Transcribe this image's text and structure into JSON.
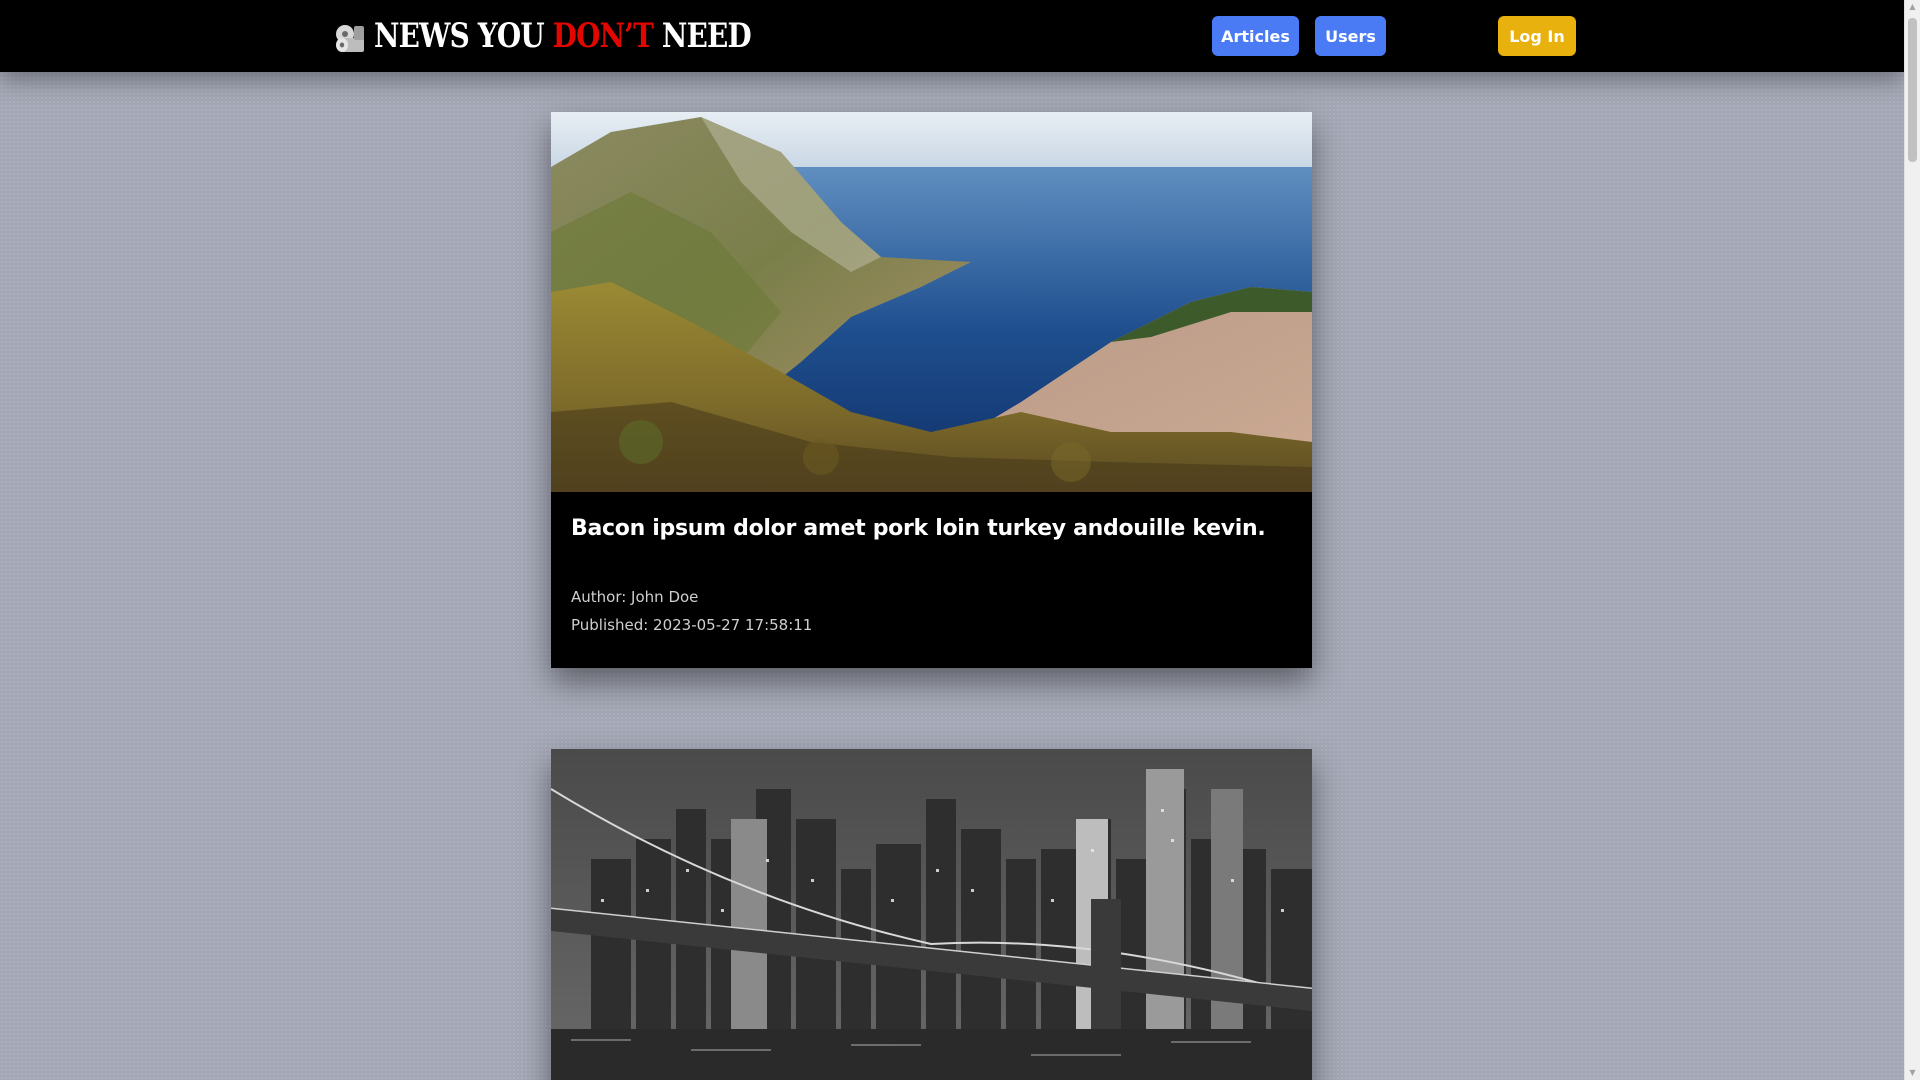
{
  "header": {
    "brand_part1": "NEWS YOU ",
    "brand_part2": "DON’T",
    "brand_part3": " NEED",
    "nav": {
      "articles_label": "Articles",
      "users_label": "Users",
      "login_label": "Log In"
    }
  },
  "articles": [
    {
      "title": "Bacon ipsum dolor amet pork loin turkey andouille kevin.",
      "author": "Author: John Doe",
      "published": "Published: 2023-05-27 17:58:11",
      "image_alt": "coastal-cliffs-photo"
    },
    {
      "image_alt": "city-bridge-night-photo"
    }
  ],
  "colors": {
    "accent_blue": "#4a7bf5",
    "accent_yellow": "#e8b10e",
    "brand_red": "#e10600",
    "page_bg": "#a4a8b6"
  }
}
